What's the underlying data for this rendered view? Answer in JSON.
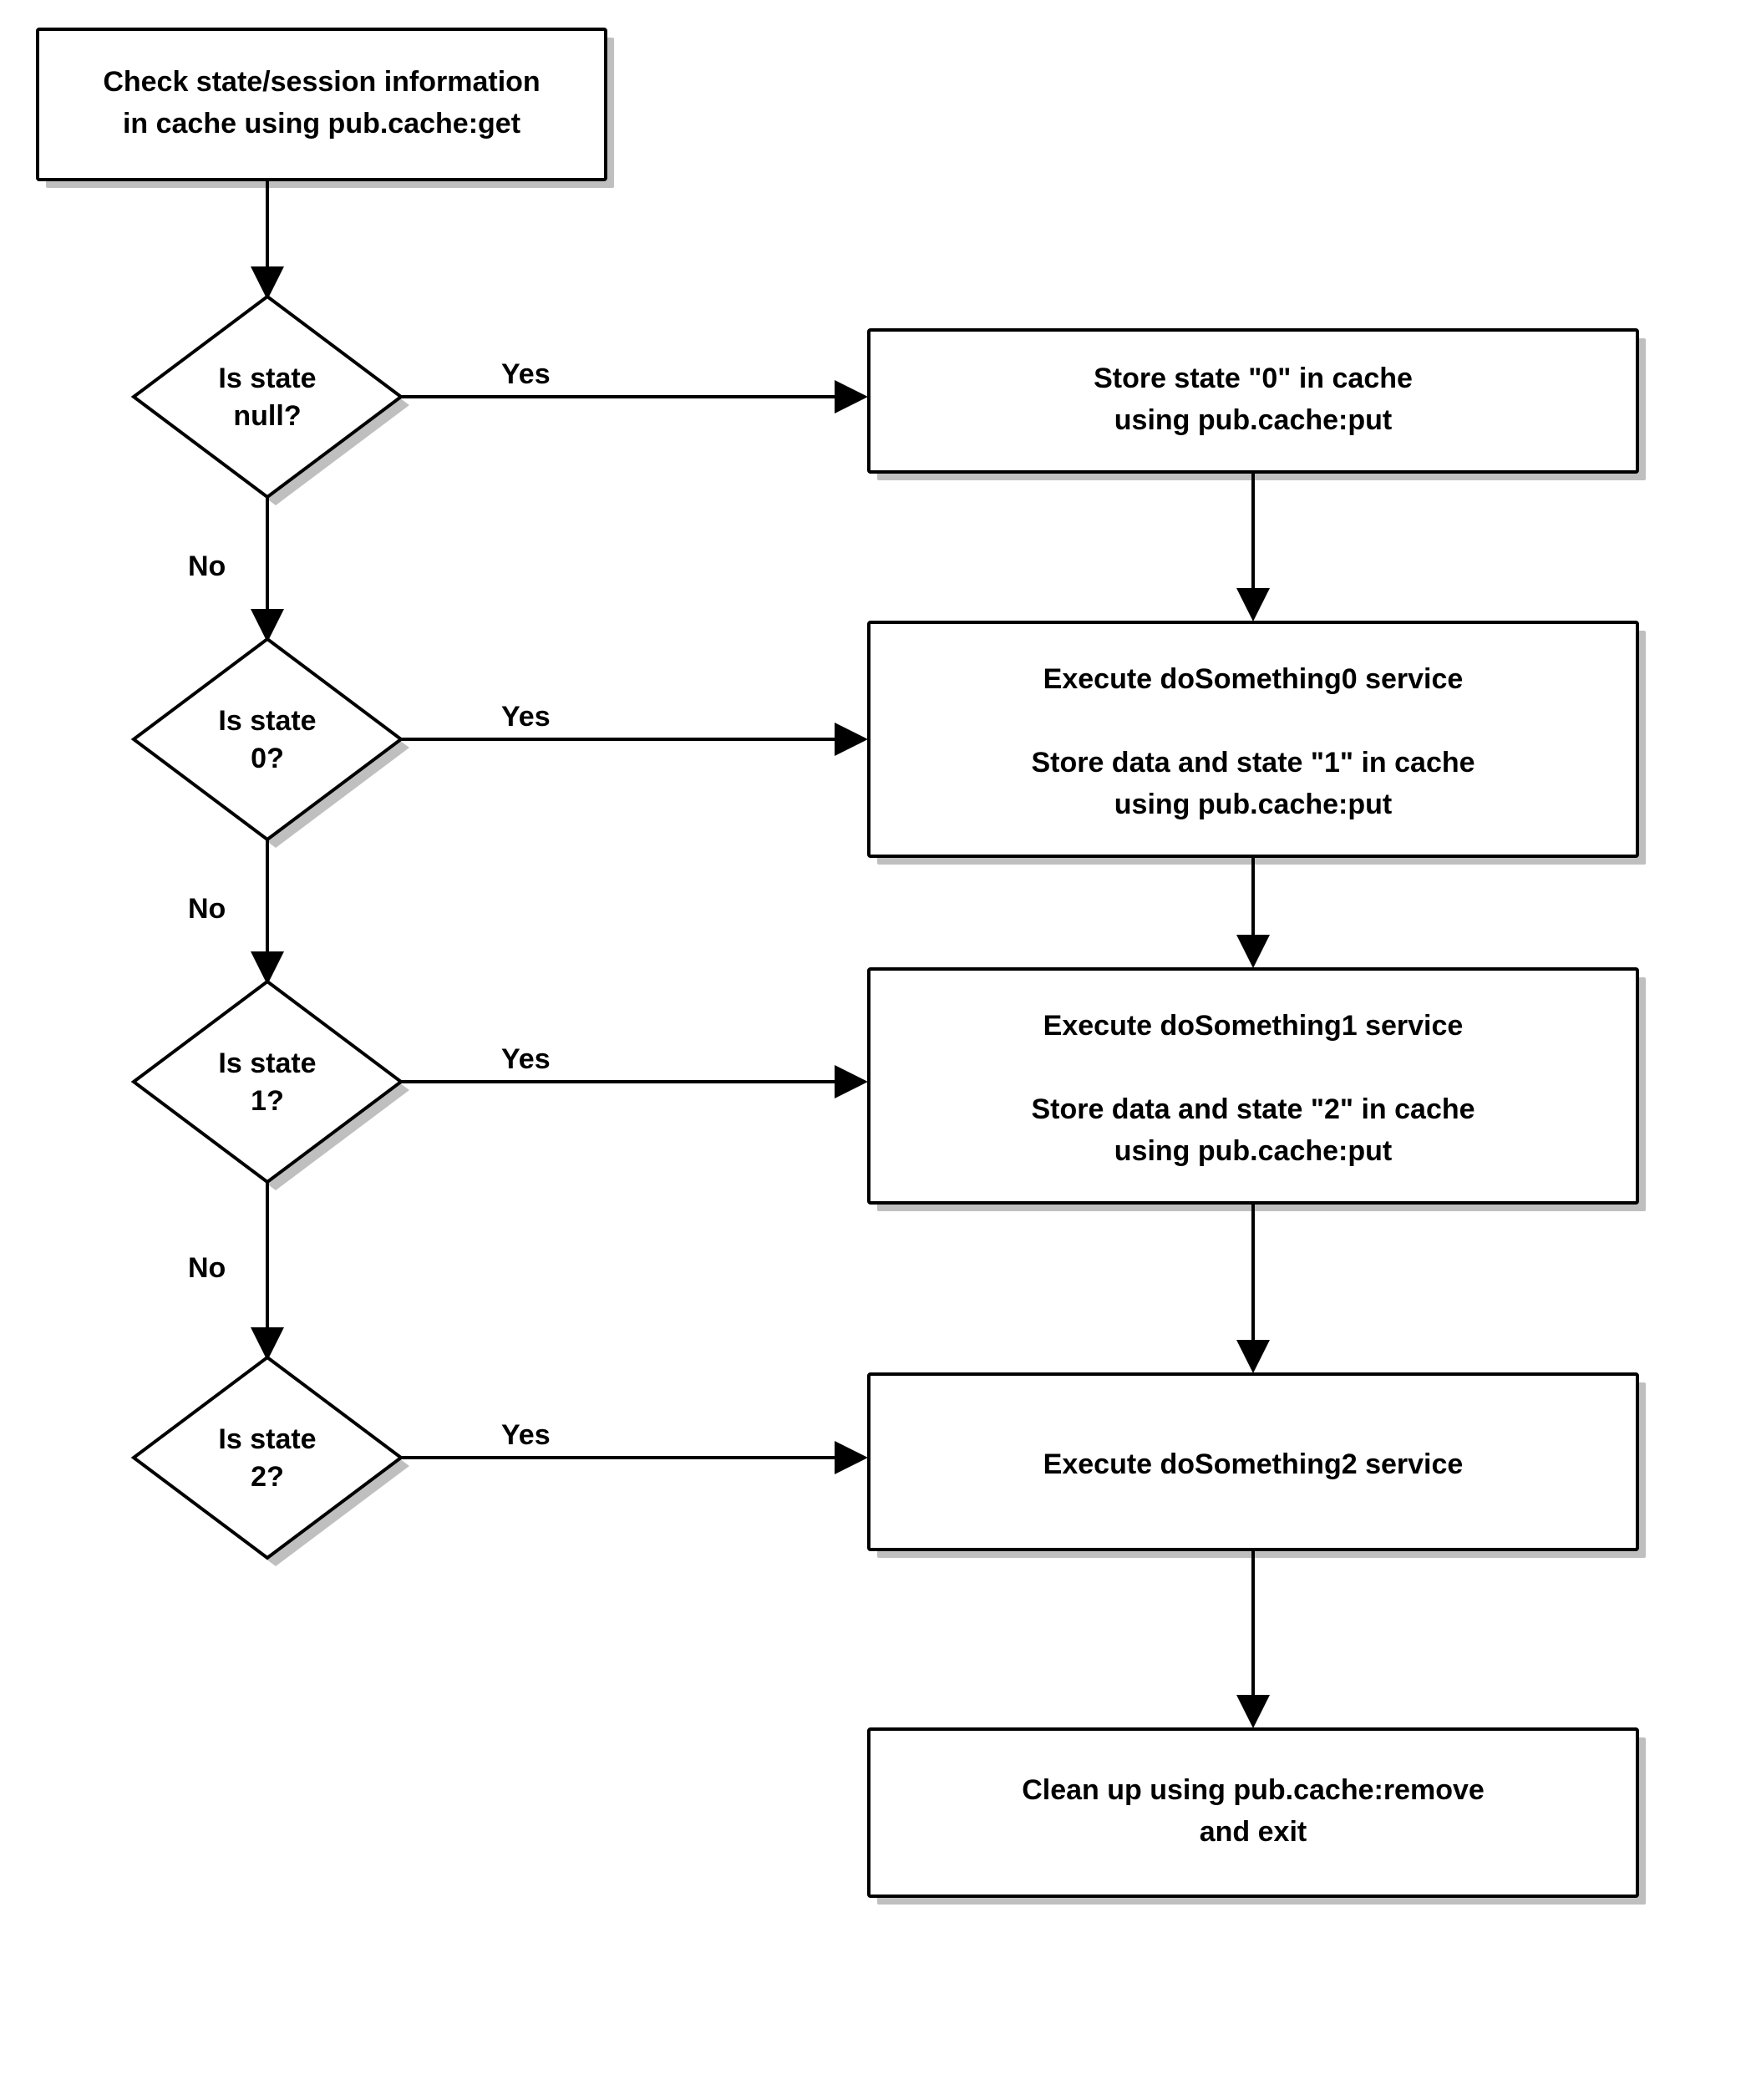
{
  "nodes": {
    "start": {
      "line1": "Check state/session information",
      "line2": "in cache using pub.cache:get"
    },
    "d_null": {
      "line1": "Is state",
      "line2": "null?"
    },
    "d_0": {
      "line1": "Is state",
      "line2": "0?"
    },
    "d_1": {
      "line1": "Is state",
      "line2": "1?"
    },
    "d_2": {
      "line1": "Is state",
      "line2": "2?"
    },
    "box0": {
      "line1": "Store state \"0\" in cache",
      "line2": "using pub.cache:put"
    },
    "box1": {
      "line1": "Execute doSomething0 service",
      "line2": "Store data and state \"1\" in cache",
      "line3": "using pub.cache:put"
    },
    "box2": {
      "line1": "Execute doSomething1 service",
      "line2": "Store data and state \"2\" in cache",
      "line3": "using pub.cache:put"
    },
    "box3": {
      "line1": "Execute doSomething2 service"
    },
    "cleanup": {
      "line1": "Clean up using pub.cache:remove",
      "line2": "and exit"
    }
  },
  "labels": {
    "yes": "Yes",
    "no": "No"
  }
}
